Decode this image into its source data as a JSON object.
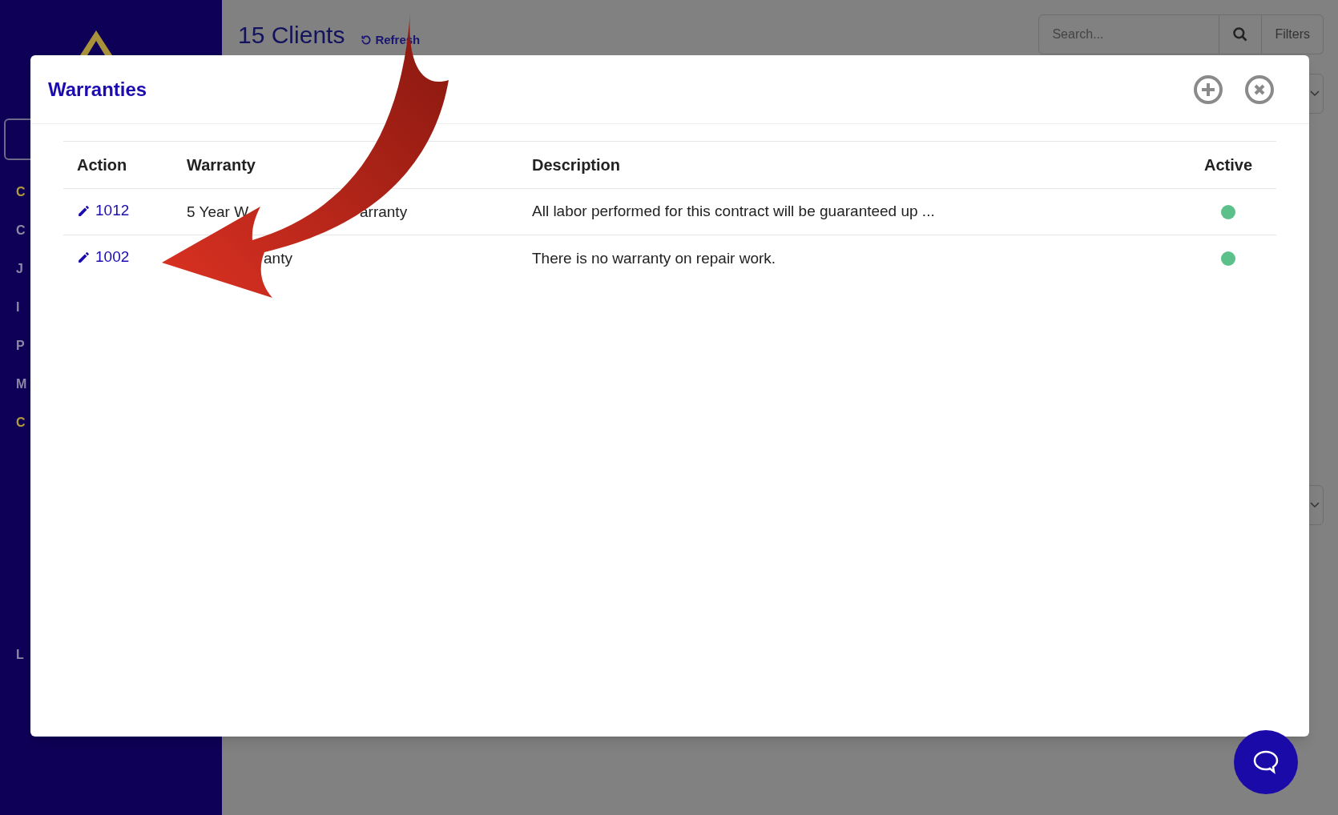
{
  "sidebar": {
    "items": [
      {
        "label": "C",
        "color": "#b39b3c"
      },
      {
        "label": "C",
        "color": "#8c8aa3"
      },
      {
        "label": "J",
        "color": "#8c8aa3"
      },
      {
        "label": "I",
        "color": "#8c8aa3"
      },
      {
        "label": "P",
        "color": "#8c8aa3"
      },
      {
        "label": "M",
        "color": "#8c8aa3"
      },
      {
        "label": "C",
        "color": "#b39b3c"
      },
      {
        "label": "L",
        "color": "#8c8aa3"
      }
    ]
  },
  "header": {
    "title": "15 Clients",
    "refresh": "Refresh",
    "search": {
      "placeholder": "Search..."
    },
    "filters": "Filters"
  },
  "modal": {
    "title": "Warranties",
    "table": {
      "columns": [
        "Action",
        "Warranty",
        "Description",
        "Active"
      ],
      "rows": [
        {
          "action": "1012",
          "warranty": [
            "5 Year W",
            "arranty"
          ],
          "description": "All labor performed for this contract will be guaranteed up ...",
          "active": true
        },
        {
          "action": "1002",
          "warranty": [
            "anty"
          ],
          "description": "There is no warranty on repair work.",
          "active": true
        }
      ]
    }
  }
}
